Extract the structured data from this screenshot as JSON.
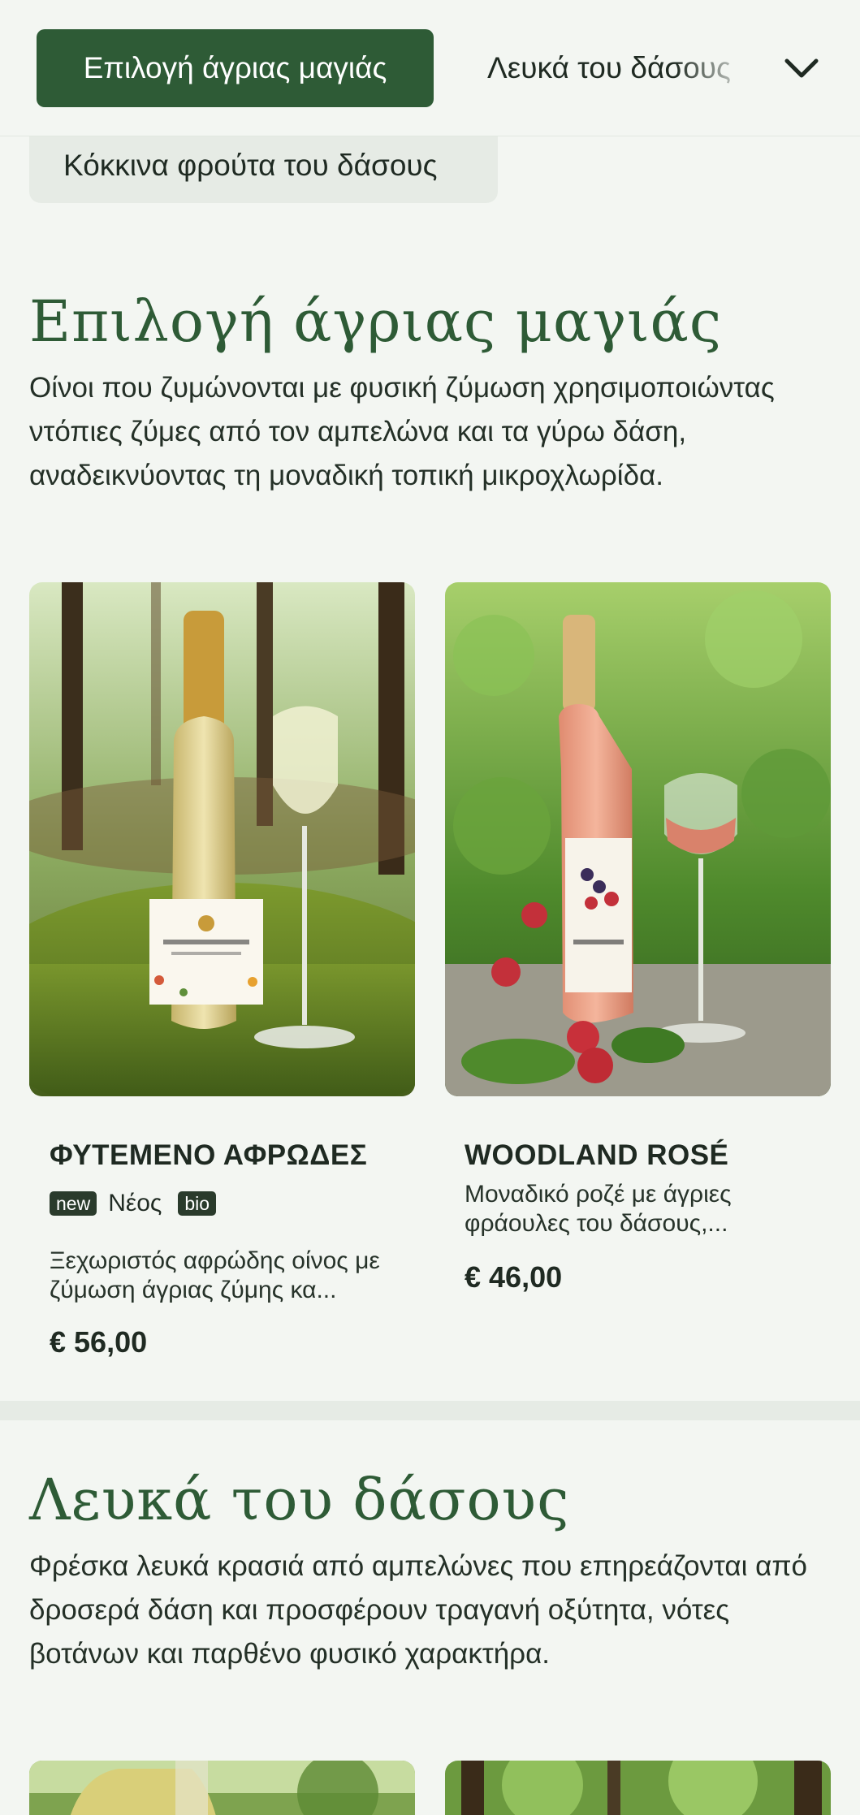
{
  "category_nav": {
    "active": "Επιλογή άγριας μαγιάς",
    "next": "Λευκά του δάσους",
    "row2": "Κόκκινα φρούτα του δάσους",
    "dropdown_icon": "chevron-down-icon"
  },
  "sections": [
    {
      "title": "Επιλογή άγριας μαγιάς",
      "description": "Οίνοι που ζυμώνονται με φυσική ζύμωση χρησιμοποιώντας ντόπιες ζύμες από τον αμπελώνα και τα γύρω δάση, αναδεικνύοντας τη μοναδική τοπική μικροχλωρίδα.",
      "products": [
        {
          "name": "ΦΥΤΕΜΕΝΟ ΑΦΡΩΔΕΣ",
          "badge_new": "new",
          "badge_new_label": "Νέος",
          "badge_bio": "bio",
          "description": "Ξεχωριστός αφρώδης οίνος με ζύμωση άγριας ζύμης κα...",
          "price": "€ 56,00"
        },
        {
          "name": "WOODLAND ROSÉ",
          "description": "Μοναδικό ροζέ με άγριες φράουλες του δάσους,...",
          "price": "€ 46,00"
        }
      ]
    },
    {
      "title": "Λευκά του δάσους",
      "description": "Φρέσκα λευκά κρασιά από αμπελώνες που επηρεάζονται από δροσερά δάση και προσφέρουν τραγανή οξύτητα, νότες βοτάνων και παρθένο φυσικό χαρακτήρα."
    }
  ],
  "colors": {
    "accent": "#2e5b36",
    "background": "#f3f6f2",
    "badge": "#2a3b2c"
  }
}
